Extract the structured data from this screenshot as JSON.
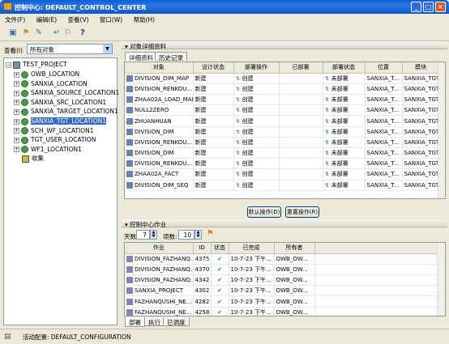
{
  "window": {
    "title": "控制中心: DEFAULT_CONTROL_CENTER"
  },
  "menu": [
    "文件(F)",
    "编辑(E)",
    "查看(V)",
    "窗口(W)",
    "帮助(H)"
  ],
  "left": {
    "view_label": "查看(I)",
    "view_value": "所有对象",
    "tree_root": "TEST_PROJECT",
    "tree_items": [
      "OWB_LOCATION",
      "SANXIA_LOCATION",
      "SANXIA_SOURCE_LOCATION1",
      "SANXIA_SRC_LOCATION1",
      "SANXIA_TARGET_LOCATION1",
      "SANXIA_TGT_LOCATION1",
      "SCH_WF_LOCATION1",
      "TGT_USER_LOCATION",
      "WF1_LOCATION1",
      "收集"
    ],
    "selected_index": 5
  },
  "details": {
    "panel_title": "对象详细资料",
    "tabs": [
      "详细资料",
      "历史记录"
    ],
    "columns": [
      "对象",
      "设计状态",
      "部署操作",
      "已部署",
      "部署状态",
      "位置",
      "模块"
    ],
    "rows": [
      [
        "DIVISION_DIM_MAP",
        "新建",
        "创建",
        "",
        "未部署",
        "SANXIA_T...",
        "SANXIA_TGT"
      ],
      [
        "DIVISION_RENKOU...",
        "新建",
        "创建",
        "",
        "未部署",
        "SANXIA_T...",
        "SANXIA_TGT"
      ],
      [
        "ZHAA02A_LOAD_MAP",
        "新建",
        "创建",
        "",
        "未部署",
        "SANXIA_T...",
        "SANXIA_TGT"
      ],
      [
        "NULL2ZERO",
        "新建",
        "创建",
        "",
        "未部署",
        "SANXIA_T...",
        "SANXIA_TGT"
      ],
      [
        "ZHUANHUAN",
        "新建",
        "创建",
        "",
        "未部署",
        "SANXIA_T...",
        "SANXIA_TGT"
      ],
      [
        "DIVISION_DIM",
        "新建",
        "创建",
        "",
        "未部署",
        "SANXIA_T...",
        "SANXIA_TGT"
      ],
      [
        "DIVISION_RENKOU...",
        "新建",
        "创建",
        "",
        "未部署",
        "SANXIA_T...",
        "SANXIA_TGT"
      ],
      [
        "DIVISION_DIM",
        "新建",
        "创建",
        "",
        "未部署",
        "SANXIA_T...",
        "SANXIA_TGT"
      ],
      [
        "DIVISION_RENKOU...",
        "新建",
        "创建",
        "",
        "未部署",
        "SANXIA_T...",
        "SANXIA_TGT"
      ],
      [
        "ZHAA02A_FACT",
        "新建",
        "创建",
        "",
        "未部署",
        "SANXIA_T...",
        "SANXIA_TGT"
      ],
      [
        "DIVISION_DIM_SEQ",
        "新建",
        "创建",
        "",
        "未部署",
        "SANXIA_T...",
        "SANXIA_TGT"
      ]
    ],
    "btn_default": "默认操作(D)",
    "btn_reset": "重置操作(R)"
  },
  "jobs": {
    "panel_title": "控制中心作业",
    "days_label": "天数:",
    "days_value": "7",
    "items_label": "项数:",
    "items_value": "10",
    "columns": [
      "作业",
      "ID",
      "状态",
      "已完成",
      "所有者"
    ],
    "rows": [
      [
        "DIVISION_FAZHANQ...",
        "4375",
        "✔",
        "10-7-23 下午...",
        "OWB_OW..."
      ],
      [
        "DIVISION_FAZHANQ...",
        "4370",
        "✔",
        "10-7-23 下午...",
        "OWB_OW..."
      ],
      [
        "DIVISION_FAZHANQ...",
        "4342",
        "✔",
        "10-7-23 下午...",
        "OWB_OW..."
      ],
      [
        "SANXIA_PROJECT",
        "4302",
        "✔",
        "10-7-23 下午...",
        "OWB_OW..."
      ],
      [
        "FAZHANQUSHI_NE...",
        "4282",
        "✔",
        "10-7-23 下午...",
        "OWB_OW..."
      ],
      [
        "FAZHANQUSHI_NE...",
        "4258",
        "✔",
        "10-7-23 下午...",
        "OWB_OW..."
      ]
    ],
    "tabs": [
      "部署",
      "执行",
      "已调度"
    ]
  },
  "status": {
    "text": "活动配置: DEFAULT_CONFIGURATION"
  }
}
